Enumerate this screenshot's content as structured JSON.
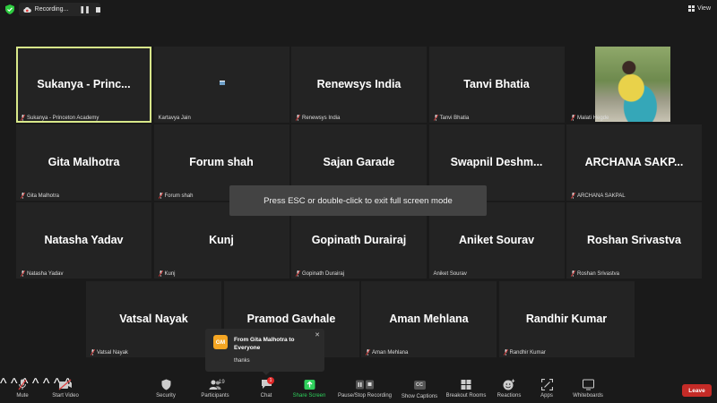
{
  "recording": {
    "label": "Recording..."
  },
  "view_button": {
    "label": "View"
  },
  "tiles": [
    {
      "name": "Sukanya  - Princ...",
      "label": "Sukanya - Princeton Academy",
      "muted": true
    },
    {
      "name": "",
      "label": "Kartavya Jain",
      "muted": false
    },
    {
      "name": "Renewsys India",
      "label": "Renewsys India",
      "muted": true
    },
    {
      "name": "Tanvi Bhatia",
      "label": "Tanvi Bhatia",
      "muted": true
    },
    {
      "name": "",
      "label": "Malati Hegde",
      "muted": true
    },
    {
      "name": "Gita Malhotra",
      "label": "Gita Malhotra",
      "muted": true
    },
    {
      "name": "Forum shah",
      "label": "Forum shah",
      "muted": true
    },
    {
      "name": "Sajan Garade",
      "label": "",
      "muted": false
    },
    {
      "name": "Swapnil  Deshm...",
      "label": "",
      "muted": false
    },
    {
      "name": "ARCHANA  SAKP...",
      "label": "ARCHANA SAKPAL",
      "muted": true
    },
    {
      "name": "Natasha Yadav",
      "label": "Natasha Yadav",
      "muted": true
    },
    {
      "name": "Kunj",
      "label": "Kunj",
      "muted": true
    },
    {
      "name": "Gopinath Durairaj",
      "label": "Gopinath Durairaj",
      "muted": true
    },
    {
      "name": "Aniket Sourav",
      "label": "Aniket Sourav",
      "muted": false
    },
    {
      "name": "Roshan Srivastva",
      "label": "Roshan Srivastva",
      "muted": true
    },
    {
      "name": "Vatsal Nayak",
      "label": "Vatsal Nayak",
      "muted": true
    },
    {
      "name": "Pramod Gavhale",
      "label": "",
      "muted": false
    },
    {
      "name": "Aman Mehlana",
      "label": "Aman Mehlana",
      "muted": true
    },
    {
      "name": "Randhir Kumar",
      "label": "Randhir Kumar",
      "muted": true
    }
  ],
  "fullscreen_notice": "Press ESC or double-click to exit full screen mode",
  "chat_notification": {
    "avatar_initials": "GM",
    "from": "From Gita Malhotra to Everyone",
    "message": "thanks"
  },
  "toolbar": {
    "mute": "Mute",
    "start_video": "Start Video",
    "security": "Security",
    "participants": "Participants",
    "participants_count": "19",
    "chat": "Chat",
    "chat_badge": "1",
    "share_screen": "Share Screen",
    "recording": "Pause/Stop Recording",
    "captions": "Show Captions",
    "captions_icon_text": "CC",
    "breakout": "Breakout Rooms",
    "reactions": "Reactions",
    "apps": "Apps",
    "whiteboards": "Whiteboards",
    "leave": "Leave"
  },
  "colors": {
    "active_speaker": "#d8e88a",
    "leave": "#c42b27",
    "share": "#2fd15c",
    "mute_icon": "#e04040"
  }
}
